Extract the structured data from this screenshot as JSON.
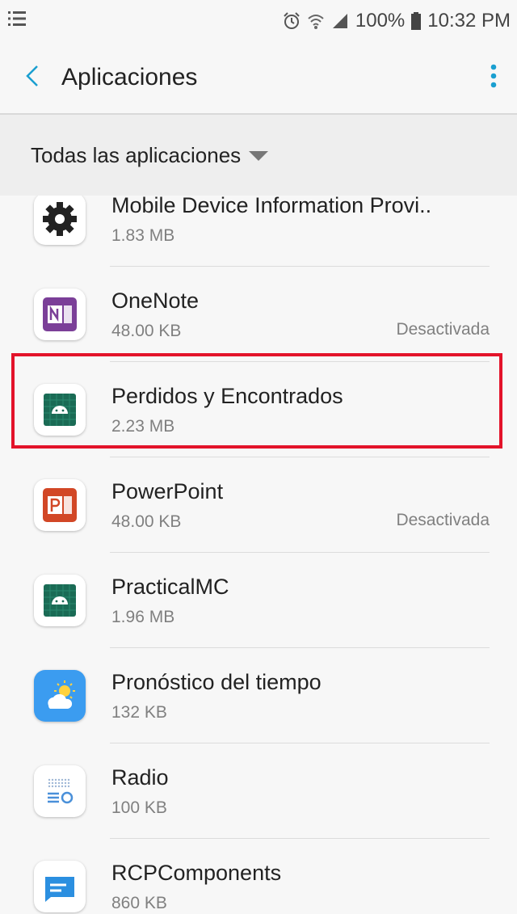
{
  "status_bar": {
    "battery": "100%",
    "time": "10:32 PM",
    "icons": [
      "menu-grid-icon",
      "alarm-icon",
      "wifi-icon",
      "signal-icon",
      "battery-icon"
    ]
  },
  "header": {
    "title": "Aplicaciones",
    "back_icon": "chevron-left-icon",
    "more_icon": "more-vert-icon"
  },
  "filter": {
    "label": "Todas las aplicaciones",
    "icon": "dropdown-arrow-icon"
  },
  "apps": [
    {
      "name": "Mobile Device Information Provi..",
      "size": "1.83 MB",
      "status": "",
      "icon": "gear-icon"
    },
    {
      "name": "OneNote",
      "size": "48.00 KB",
      "status": "Desactivada",
      "icon": "onenote-icon"
    },
    {
      "name": "Perdidos y Encontrados",
      "size": "2.23 MB",
      "status": "",
      "icon": "android-icon"
    },
    {
      "name": "PowerPoint",
      "size": "48.00 KB",
      "status": "Desactivada",
      "icon": "powerpoint-icon"
    },
    {
      "name": "PracticalMC",
      "size": "1.96 MB",
      "status": "",
      "icon": "android-icon"
    },
    {
      "name": "Pronóstico del tiempo",
      "size": "132 KB",
      "status": "",
      "icon": "weather-icon"
    },
    {
      "name": "Radio",
      "size": "100 KB",
      "status": "",
      "icon": "radio-icon"
    },
    {
      "name": "RCPComponents",
      "size": "860 KB",
      "status": "",
      "icon": "message-icon"
    }
  ],
  "colors": {
    "accent": "#1a9fd0",
    "highlight": "#e3132a",
    "onenote": "#7b3f98",
    "powerpoint": "#d24726",
    "android_green": "#1a6b55"
  }
}
